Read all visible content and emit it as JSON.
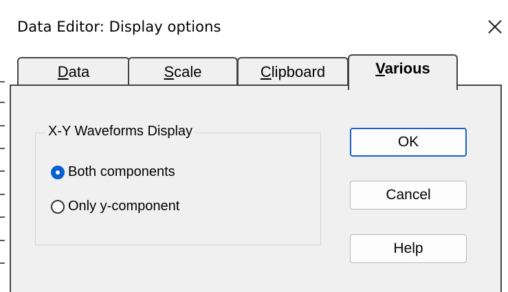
{
  "dialog": {
    "title": "Data Editor: Display options",
    "close_icon": "close-icon"
  },
  "tabs": [
    {
      "label": "Data",
      "active": false
    },
    {
      "label": "Scale",
      "active": false
    },
    {
      "label": "Clipboard",
      "active": false
    },
    {
      "label": "Various",
      "active": true
    }
  ],
  "group": {
    "caption": "X-Y Waveforms Display",
    "options": [
      {
        "label": "Both components",
        "checked": true
      },
      {
        "label": "Only y-component",
        "checked": false
      }
    ]
  },
  "buttons": {
    "ok": "OK",
    "cancel": "Cancel",
    "help": "Help"
  },
  "colors": {
    "accent": "#0a5fd0",
    "default_button_border": "#1c60c8",
    "panel": "#f0f0f0"
  }
}
